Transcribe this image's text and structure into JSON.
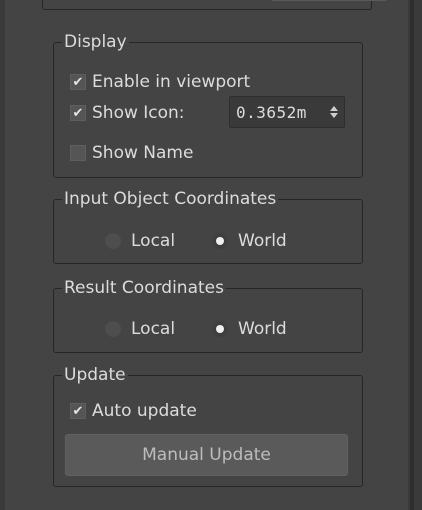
{
  "display": {
    "title": "Display",
    "enable_in_viewport": {
      "label": "Enable in viewport",
      "checked": true
    },
    "show_icon": {
      "label": "Show Icon:",
      "checked": true,
      "value": "0.3652m"
    },
    "show_name": {
      "label": "Show Name",
      "checked": false
    }
  },
  "input_coordinates": {
    "title": "Input Object Coordinates",
    "options": [
      {
        "label": "Local",
        "selected": false
      },
      {
        "label": "World",
        "selected": true
      }
    ]
  },
  "result_coordinates": {
    "title": "Result Coordinates",
    "options": [
      {
        "label": "Local",
        "selected": false
      },
      {
        "label": "World",
        "selected": true
      }
    ]
  },
  "update": {
    "title": "Update",
    "auto_update": {
      "label": "Auto update",
      "checked": true
    },
    "manual_update_label": "Manual Update"
  },
  "icons": {
    "check": "✔"
  },
  "colors": {
    "panel_bg": "#444444",
    "group_border": "#262626",
    "text": "#dcdcdc",
    "button_bg": "#5a5a5a"
  }
}
